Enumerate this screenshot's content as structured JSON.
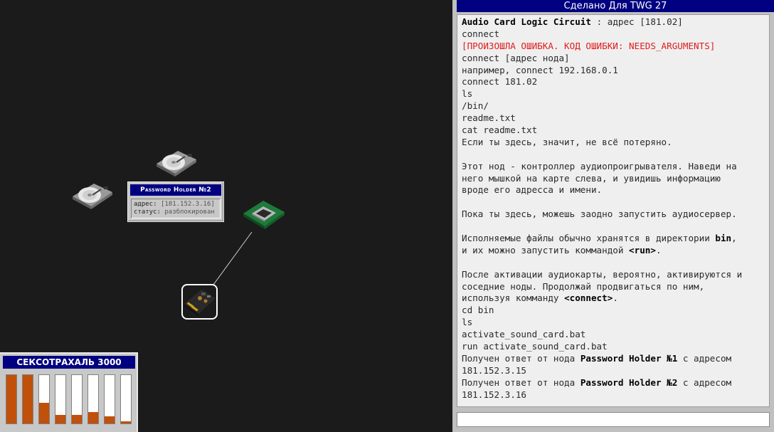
{
  "map": {
    "tooltip": {
      "title": "Password Holder №2",
      "address_label": "адрес:",
      "address_value": "[181.152.3.16]",
      "status_label": "статус:",
      "status_value": "разблокирован"
    }
  },
  "equalizer": {
    "title": "СЕКСОТРАХАЛЬ 3000",
    "levels": [
      1.0,
      1.0,
      0.42,
      0.17,
      0.17,
      0.23,
      0.15,
      0.05
    ],
    "fill_color": "#c0500a"
  },
  "terminal": {
    "title": "Сделано Для TWG 27",
    "input_value": "",
    "lines": [
      {
        "text": "Audio Card Logic Circuit : адрес [181.02]"
      },
      {
        "text": "connect"
      },
      {
        "text": "[ПРОИЗОШЛА ОШИБКА. КОД ОШИБКИ: NEEDS_ARGUMENTS]",
        "error": true
      },
      {
        "text": "connect [адрес нода]"
      },
      {
        "text": "например, connect 192.168.0.1"
      },
      {
        "text": "connect 181.02"
      },
      {
        "text": "ls"
      },
      {
        "text": "/bin/"
      },
      {
        "text": "readme.txt"
      },
      {
        "text": "cat readme.txt"
      },
      {
        "text": "Если ты здесь, значит, не всё потеряно."
      },
      {
        "text": ""
      },
      {
        "text": "Этот нод - контроллер аудиопроигрывателя. Наведи на"
      },
      {
        "text": "него мышкой на карте слева, и увидишь информацию"
      },
      {
        "text": "вроде его адресса и имени."
      },
      {
        "text": ""
      },
      {
        "text": "Пока ты здесь, можешь заодно запустить аудиосервер."
      },
      {
        "text": ""
      },
      {
        "text": "Исполняемые файлы обычно хранятся в директории bin,"
      },
      {
        "text": "и их можно запустить коммандой <run>."
      },
      {
        "text": ""
      },
      {
        "text": "После активации аудиокарты, вероятно, активируются и"
      },
      {
        "text": "соседние ноды. Продолжай продвигаться по ним,"
      },
      {
        "text": "используя комманду <connect>."
      },
      {
        "text": "cd bin"
      },
      {
        "text": "ls"
      },
      {
        "text": "activate_sound_card.bat"
      },
      {
        "text": "run activate_sound_card.bat"
      },
      {
        "text": "Получен ответ от нода Password Holder №1 с адресом"
      },
      {
        "text": "181.152.3.15"
      },
      {
        "text": "Получен ответ от нода Password Holder №2 с адресом"
      },
      {
        "text": "181.152.3.16"
      }
    ]
  }
}
